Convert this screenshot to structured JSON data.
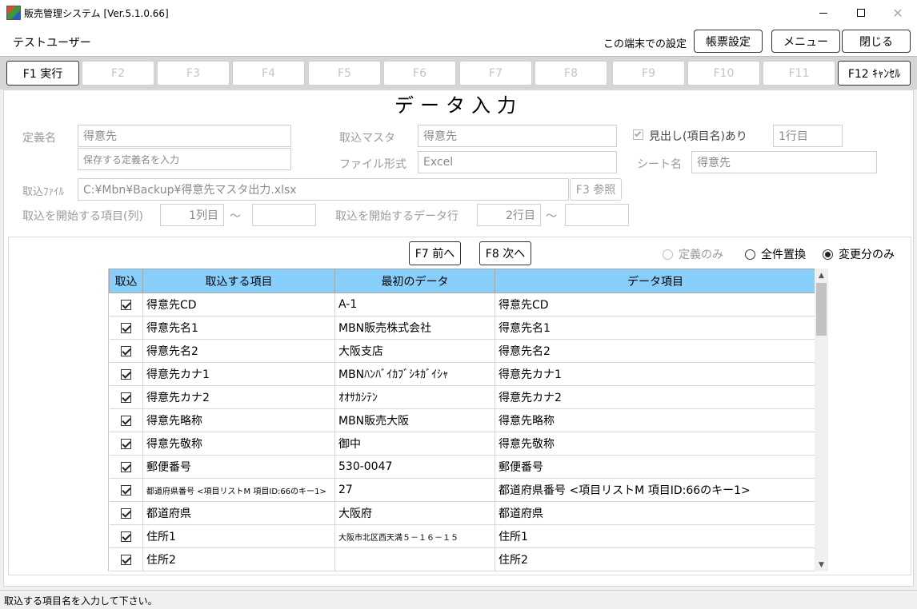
{
  "window": {
    "title": "販売管理システム [Ver.5.1.0.66]",
    "close_glyph": "✕"
  },
  "header": {
    "user": "テストユーザー",
    "terminal_settings": "この端末での設定",
    "report_settings": "帳票設定",
    "menu": "メニュー",
    "close": "閉じる"
  },
  "fkeys": [
    "F1 実行",
    "F2",
    "F3",
    "F4",
    "F5",
    "F6",
    "F7",
    "F8",
    "F9",
    "F10",
    "F11",
    "F12 ｷｬﾝｾﾙ"
  ],
  "page_title": "データ入力",
  "form": {
    "definition_label": "定義名",
    "definition_value": "得意先",
    "definition_placeholder": "保存する定義名を入力",
    "import_master_label": "取込マスタ",
    "import_master_value": "得意先",
    "header_row_label": "見出し(項目名)あり",
    "header_row_value": "1行目",
    "file_format_label": "ファイル形式",
    "file_format_value": "Excel",
    "sheet_label": "シート名",
    "sheet_value": "得意先",
    "import_file_label": "取込ﾌｧｲﾙ",
    "import_file_value": "C:¥Mbn¥Backup¥得意先マスタ出力.xlsx",
    "browse_button": "F3 参照",
    "start_column_label": "取込を開始する項目(列)",
    "start_column_value": "1列目",
    "start_row_label": "取込を開始するデータ行",
    "start_row_value": "2行目",
    "tilde": "～"
  },
  "nav": {
    "prev": "F7 前へ",
    "next": "F8 次へ"
  },
  "radios": [
    {
      "label": "定義のみ",
      "selected": false,
      "disabled": true
    },
    {
      "label": "全件置換",
      "selected": false,
      "disabled": false
    },
    {
      "label": "変更分のみ",
      "selected": true,
      "disabled": false
    }
  ],
  "grid": {
    "columns": [
      "取込",
      "取込する項目",
      "最初のデータ",
      "データ項目"
    ],
    "rows": [
      {
        "checked": true,
        "item": "得意先CD",
        "first": "A-1",
        "data_item": "得意先CD"
      },
      {
        "checked": true,
        "item": "得意先名1",
        "first": "MBN販売株式会社",
        "data_item": "得意先名1"
      },
      {
        "checked": true,
        "item": "得意先名2",
        "first": "大阪支店",
        "data_item": "得意先名2"
      },
      {
        "checked": true,
        "item": "得意先カナ1",
        "first": "MBNﾊﾝﾊﾞｲｶﾌﾞｼｷｶﾞｲｼｬ",
        "data_item": "得意先カナ1"
      },
      {
        "checked": true,
        "item": "得意先カナ2",
        "first": "ｵｵｻｶｼﾃﾝ",
        "data_item": "得意先カナ2"
      },
      {
        "checked": true,
        "item": "得意先略称",
        "first": "MBN販売大阪",
        "data_item": "得意先略称"
      },
      {
        "checked": true,
        "item": "得意先敬称",
        "first": "御中",
        "data_item": "得意先敬称"
      },
      {
        "checked": true,
        "item": "郵便番号",
        "first": "530-0047",
        "data_item": "郵便番号"
      },
      {
        "checked": true,
        "item": "都道府県番号 <項目リストM 項目ID:66のキー1>",
        "first": "27",
        "data_item": "都道府県番号 <項目リストM 項目ID:66のキー1>",
        "small_item": true
      },
      {
        "checked": true,
        "item": "都道府県",
        "first": "大阪府",
        "data_item": "都道府県"
      },
      {
        "checked": true,
        "item": "住所1",
        "first": "大阪市北区西天満５－１６－１５",
        "data_item": "住所1",
        "small_first": true
      },
      {
        "checked": true,
        "item": "住所2",
        "first": "",
        "data_item": "住所2"
      }
    ]
  },
  "status": "取込する項目名を入力して下さい。"
}
